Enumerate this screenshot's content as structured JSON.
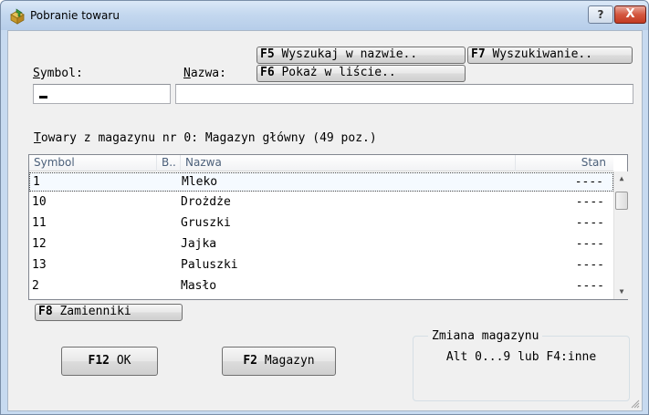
{
  "window": {
    "title": "Pobranie towaru",
    "help_label": "?",
    "close_label": "X"
  },
  "toolbar": {
    "search_in_name": {
      "key": "F5",
      "label": " Wyszukaj w nazwie.."
    },
    "search": {
      "key": "F7",
      "label": " Wyszukiwanie.."
    },
    "show_in_list": {
      "key": "F6",
      "label": " Pokaż w liście.."
    }
  },
  "form": {
    "symbol_label_accel": "S",
    "symbol_label_rest": "ymbol:",
    "name_label_accel": "N",
    "name_label_rest": "azwa:",
    "symbol_value": "",
    "name_value": ""
  },
  "goods": {
    "caption_accel": "T",
    "caption_rest": "owary z magazynu nr 0: Magazyn główny (49 poz.)",
    "columns": [
      "Symbol",
      "B..",
      "Nazwa",
      "Stan"
    ],
    "rows": [
      {
        "symbol": "1",
        "name": "Mleko",
        "stan": "----"
      },
      {
        "symbol": "10",
        "name": "Drożdże",
        "stan": "----"
      },
      {
        "symbol": "11",
        "name": "Gruszki",
        "stan": "----"
      },
      {
        "symbol": "12",
        "name": "Jajka",
        "stan": "----"
      },
      {
        "symbol": "13",
        "name": "Paluszki",
        "stan": "----"
      },
      {
        "symbol": "2",
        "name": "Masło",
        "stan": "----"
      }
    ],
    "selected_row": 0
  },
  "actions": {
    "substitutes": {
      "key": "F8",
      "label": " Zamienniki"
    },
    "ok": {
      "key": "F12",
      "label": " OK"
    },
    "warehouse": {
      "key": "F2",
      "label": " Magazyn"
    }
  },
  "warehouse_change": {
    "legend": "Zmiana magazynu",
    "hint": "Alt 0...9 lub F4:inne"
  },
  "colors": {
    "title_gradient_top": "#dbe8f7",
    "close_red": "#c23a22",
    "dialog_bg": "#f0f0f0",
    "header_text": "#4c607a"
  },
  "icons": {
    "app": "package-arrow-icon",
    "scroll_up": "chevron-up-icon",
    "scroll_down": "chevron-down-icon",
    "resize": "resize-grip-icon"
  }
}
